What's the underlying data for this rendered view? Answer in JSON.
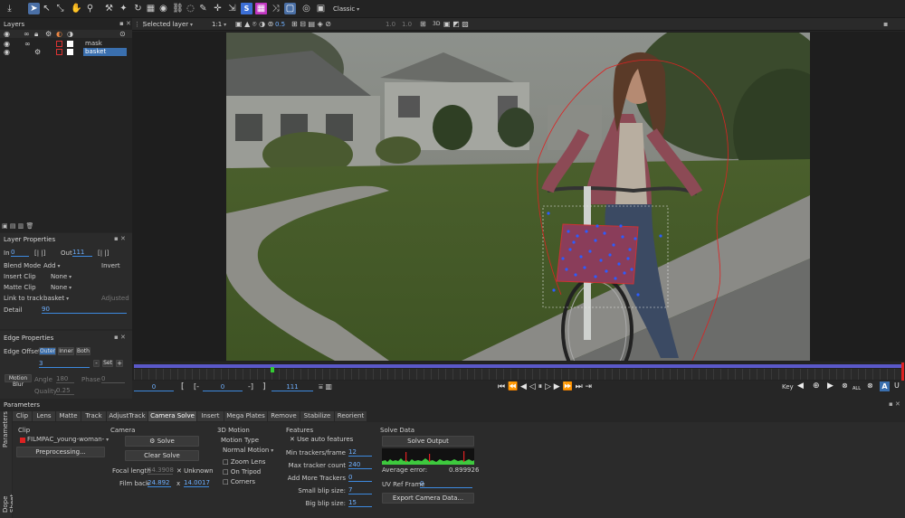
{
  "toolbar": {
    "workspace": "Classic",
    "icons": [
      "save-icon",
      "pointer-icon",
      "select-icon",
      "transform-icon",
      "hand-icon",
      "zoom-icon",
      "magic-icon",
      "rotate-icon",
      "disc-icon",
      "link-icon",
      "shape-icon",
      "pen-icon",
      "move-icon",
      "arrows-icon",
      "s-icon",
      "grid-icon",
      "shuffle-icon",
      "box-icon",
      "eye-icon",
      "color-icon"
    ]
  },
  "viewer_bar": {
    "layer_select": "Selected layer",
    "zoom": "1:1",
    "opacity": "0.5",
    "val_a": "1.0",
    "val_b": "1.0",
    "mode": "3D"
  },
  "layers": {
    "title": "Layers",
    "items": [
      {
        "name": "mask"
      },
      {
        "name": "basket"
      }
    ]
  },
  "layer_props": {
    "title": "Layer Properties",
    "in_label": "In",
    "in_value": "0",
    "out_label": "Out",
    "out_value": "111",
    "blend_label": "Blend Mode",
    "blend_value": "Add",
    "invert_label": "Invert",
    "insert_label": "Insert Clip",
    "insert_value": "None",
    "matte_label": "Matte Clip",
    "matte_value": "None",
    "link_label": "Link to track",
    "link_value": "basket",
    "adjusted_label": "Adjusted",
    "detail_label": "Detail",
    "detail_value": "90"
  },
  "edge_props": {
    "title": "Edge Properties",
    "offset_label": "Edge Offset",
    "outer": "Outer",
    "inner": "Inner",
    "both": "Both",
    "offset_value": "3",
    "set": "Set",
    "motion_blur": "Motion Blur",
    "angle_label": "Angle",
    "angle_value": "180",
    "phase_label": "Phase",
    "phase_value": "0",
    "quality_label": "Quality",
    "quality_value": "0.25"
  },
  "timeline": {
    "start": "0",
    "in": "0",
    "out": "111",
    "key_label": "Key",
    "all_label": "ALL"
  },
  "parameters": {
    "title": "Parameters",
    "side_tabs": [
      "Parameters",
      "Dope Sheet"
    ],
    "tabs": [
      "Clip",
      "Lens",
      "Matte",
      "Track",
      "AdjustTrack",
      "Camera Solve",
      "Insert",
      "Mega Plates",
      "Remove",
      "Stabilize",
      "Reorient"
    ],
    "active_tab": "Camera Solve",
    "clip": {
      "title": "Clip",
      "clip_name": "FILMPAC_young-woman-",
      "preprocessing": "Preprocessing..."
    },
    "camera": {
      "title": "Camera",
      "solve": "Solve",
      "clear_solve": "Clear Solve",
      "focal_label": "Focal length",
      "focal_value": "44.3908",
      "unknown_label": "Unknown",
      "filmback_label": "Film back",
      "filmback_w": "24.892",
      "x_label": "x",
      "filmback_h": "14.0017"
    },
    "motion": {
      "title": "3D Motion",
      "type_label": "Motion Type",
      "type_value": "Normal Motion",
      "zoom_lens": "Zoom Lens",
      "on_tripod": "On Tripod",
      "corners": "Corners"
    },
    "features": {
      "title": "Features",
      "auto": "Use auto features",
      "min_label": "Min trackers/frame",
      "min_value": "12",
      "max_label": "Max tracker count",
      "max_value": "240",
      "add_label": "Add More Trackers",
      "add_value": "0",
      "small_label": "Small blip size:",
      "small_value": "7",
      "big_label": "Big blip size:",
      "big_value": "15"
    },
    "solve_data": {
      "title": "Solve Data",
      "solve_output": "Solve Output",
      "avg_label": "Average error:",
      "avg_value": "0.899926",
      "uv_label": "UV Ref Frame",
      "uv_value": "0",
      "export": "Export Camera Data..."
    }
  }
}
